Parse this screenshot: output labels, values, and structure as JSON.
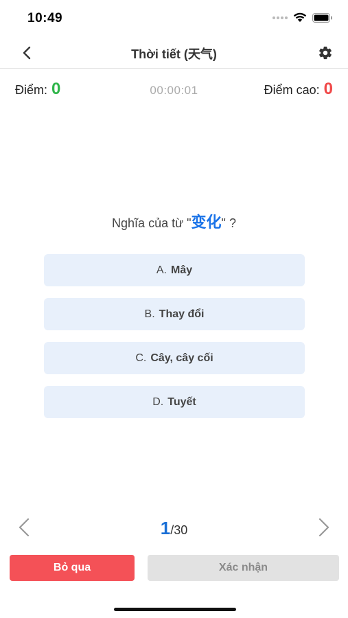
{
  "status_bar": {
    "time": "10:49"
  },
  "nav": {
    "title": "Thời tiết (天气)",
    "back_icon": "chevron-left-icon",
    "settings_icon": "gear-icon"
  },
  "score": {
    "label": "Điểm:",
    "value": "0",
    "timer": "00:00:01",
    "high_label": "Điểm cao:",
    "high_value": "0"
  },
  "question": {
    "prefix": "Nghĩa của từ \"",
    "word": "变化",
    "suffix": "\" ?"
  },
  "options": [
    {
      "letter": "A.",
      "text": "Mây"
    },
    {
      "letter": "B.",
      "text": "Thay đổi"
    },
    {
      "letter": "C.",
      "text": "Cây, cây cối"
    },
    {
      "letter": "D.",
      "text": "Tuyết"
    }
  ],
  "pager": {
    "current": "1",
    "total": "/30"
  },
  "actions": {
    "skip_label": "Bỏ qua",
    "confirm_label": "Xác nhận"
  },
  "colors": {
    "accent_blue": "#1a73e8",
    "score_green": "#2fb54a",
    "score_red": "#f04848",
    "skip_red": "#f45157",
    "option_bg": "#e8f0fb"
  }
}
